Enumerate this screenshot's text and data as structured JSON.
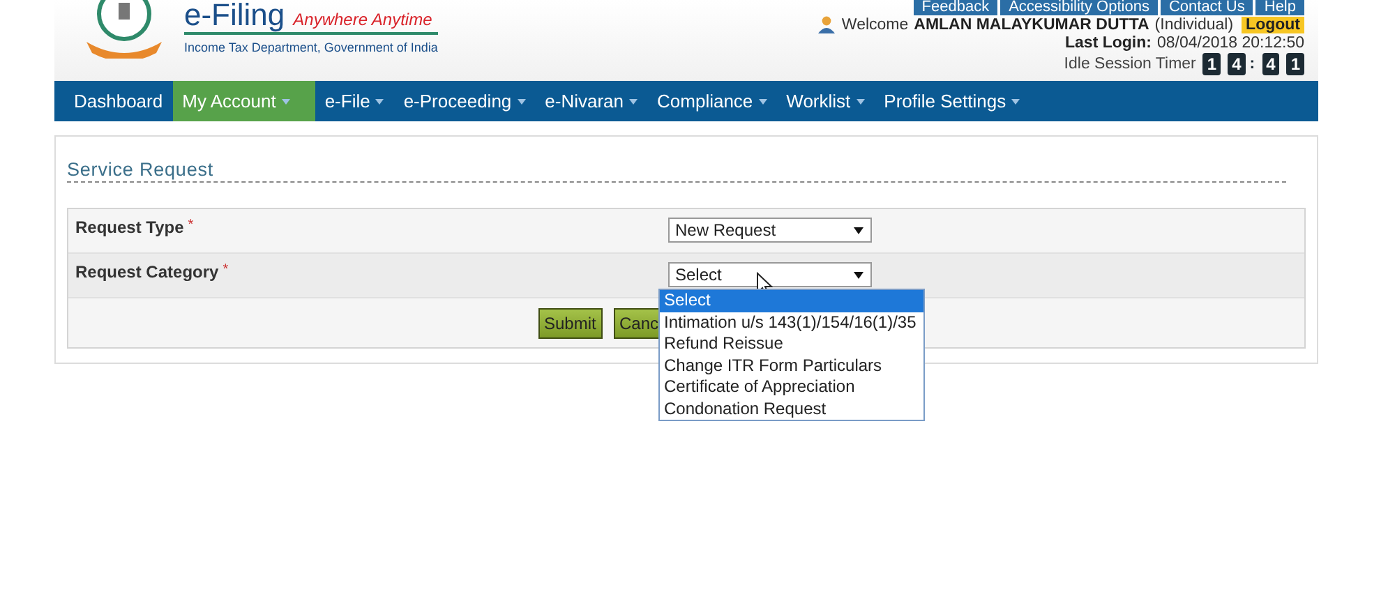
{
  "header": {
    "logo_title": "e-Filing",
    "tagline": "Anywhere Anytime",
    "department": "Income Tax Department, Government of India",
    "top_links": [
      "Feedback",
      "Accessibility Options",
      "Contact Us",
      "Help"
    ],
    "welcome": "Welcome",
    "user_name": "AMLAN MALAYKUMAR DUTTA",
    "user_type": "(Individual)",
    "logout": "Logout",
    "last_login_label": "Last Login:",
    "last_login": "08/04/2018 20:12:50",
    "timer_label": "Idle Session Timer",
    "timer_digits": [
      "1",
      "4",
      ":",
      "4",
      "1"
    ]
  },
  "nav": [
    {
      "label": "Dashboard",
      "selected": false,
      "dropdown": false
    },
    {
      "label": "My Account",
      "selected": true,
      "dropdown": true
    },
    {
      "label": "e-File",
      "selected": false,
      "dropdown": true
    },
    {
      "label": "e-Proceeding",
      "selected": false,
      "dropdown": true
    },
    {
      "label": "e-Nivaran",
      "selected": false,
      "dropdown": true
    },
    {
      "label": "Compliance",
      "selected": false,
      "dropdown": true
    },
    {
      "label": "Worklist",
      "selected": false,
      "dropdown": true
    },
    {
      "label": "Profile Settings",
      "selected": false,
      "dropdown": true
    }
  ],
  "page_title": "Service Request",
  "fields": [
    {
      "label": "Request Type",
      "required": "*",
      "value": "New Request"
    },
    {
      "label": "Request Category",
      "required": "*",
      "value": "Select"
    }
  ],
  "buttons": [
    "Submit",
    "Canc"
  ],
  "dropdown_options": [
    {
      "label": "Select",
      "selected": true
    },
    {
      "label": "Intimation u/s 143(1)/154/16(1)/35",
      "selected": false
    },
    {
      "label": "Refund Reissue",
      "selected": false
    },
    {
      "label": "Change ITR Form Particulars",
      "selected": false
    },
    {
      "label": "Certificate of Appreciation",
      "selected": false
    },
    {
      "label": "Condonation Request",
      "selected": false
    }
  ]
}
